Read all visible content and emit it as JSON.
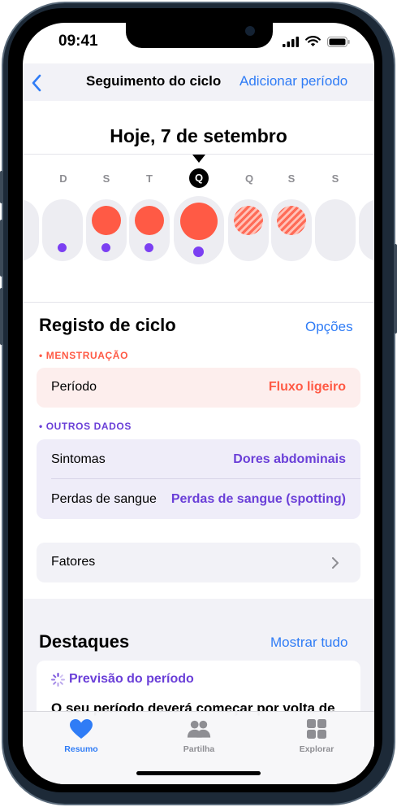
{
  "status": {
    "time": "09:41"
  },
  "nav": {
    "title": "Seguimento do ciclo",
    "action": "Adicionar período"
  },
  "timeline": {
    "date": "Hoje, 7 de setembro",
    "days": [
      "D",
      "S",
      "T",
      "Q",
      "Q",
      "S",
      "S"
    ]
  },
  "cycle_log": {
    "title": "Registo de ciclo",
    "options": "Opções",
    "menstruation_label": "• MENSTRUAÇÃO",
    "period_label": "Período",
    "period_value": "Fluxo ligeiro",
    "other_label": "• OUTROS DADOS",
    "symptoms_label": "Sintomas",
    "symptoms_value": "Dores abdominais",
    "spotting_label": "Perdas de sangue",
    "spotting_value": "Perdas de sangue (spotting)",
    "factors_label": "Fatores"
  },
  "highlights": {
    "title": "Destaques",
    "show_all": "Mostrar tudo",
    "prediction_title": "Previsão do período",
    "prediction_text": "O seu período deverá começar por volta de"
  },
  "tabs": [
    {
      "label": "Resumo",
      "icon": "heart-icon",
      "active": true
    },
    {
      "label": "Partilha",
      "icon": "people-icon",
      "active": false
    },
    {
      "label": "Explorar",
      "icon": "grid-icon",
      "active": false
    }
  ],
  "colors": {
    "accent": "#2f7cf6",
    "period": "#ff5a45",
    "symptom": "#7b3ff2",
    "menstruation_bg": "#fdeeed",
    "other_bg": "#efedf9"
  }
}
